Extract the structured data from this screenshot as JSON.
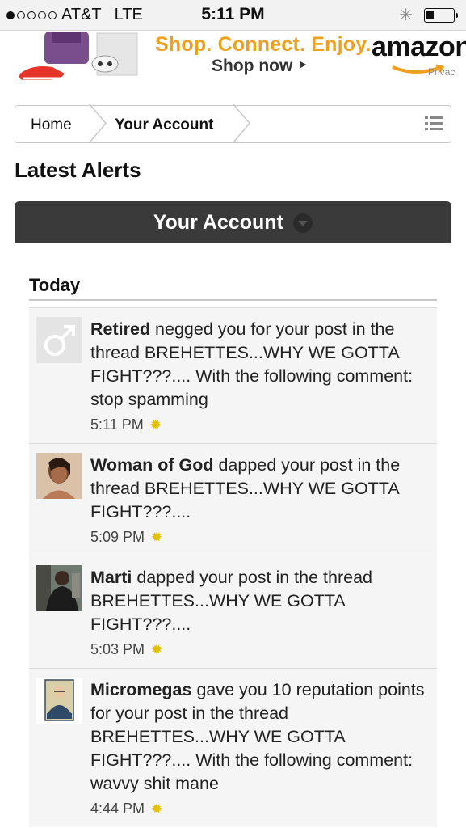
{
  "status_bar": {
    "signal_dots_filled": 1,
    "signal_dots_total": 5,
    "carrier": "AT&T",
    "network": "LTE",
    "time": "5:11 PM",
    "battery_level": 0.3
  },
  "ad": {
    "tagline": "Shop. Connect. Enjoy.",
    "cta": "Shop now ‣",
    "brand": "amazon",
    "privacy": "Privac"
  },
  "breadcrumb": {
    "home": "Home",
    "current": "Your Account"
  },
  "page_title": "Latest Alerts",
  "account_bar": {
    "title": "Your Account"
  },
  "section": {
    "heading": "Today"
  },
  "alerts": [
    {
      "user": "Retired",
      "text": " negged you for your post in the thread BREHETTES...WHY WE GOTTA FIGHT???.... With the following comment: stop spamming",
      "time": "5:11 PM",
      "avatar": "male-symbol-icon"
    },
    {
      "user": "Woman of God",
      "text": " dapped your post in the thread BREHETTES...WHY WE GOTTA FIGHT???....",
      "time": "5:09 PM",
      "avatar": "user-photo"
    },
    {
      "user": "Marti",
      "text": " dapped your post in the thread BREHETTES...WHY WE GOTTA FIGHT???....",
      "time": "5:03 PM",
      "avatar": "user-photo"
    },
    {
      "user": "Micromegas",
      "text": " gave you 10 reputation points for your post in the thread BREHETTES...WHY WE GOTTA FIGHT???.... With the following comment: wavvy shit mane",
      "time": "4:44 PM",
      "avatar": "portrait-poster"
    }
  ],
  "colors": {
    "header_bar": "#3a3a3a",
    "ad_tagline": "#f0a020",
    "alert_bg": "#f5f5f5",
    "time_icon": "#e0c000"
  }
}
